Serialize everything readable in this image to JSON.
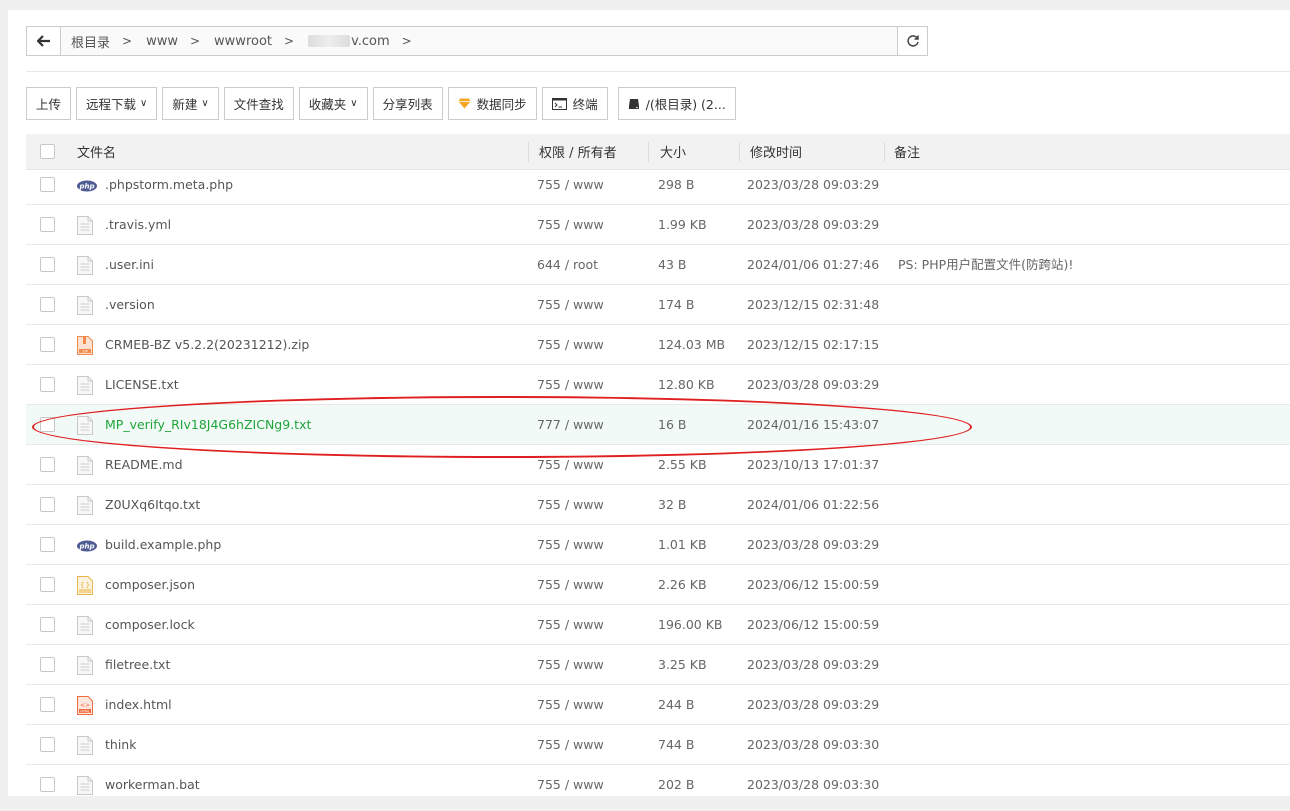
{
  "pathbar": {
    "crumbs": [
      "根目录",
      "www",
      "wwwroot"
    ],
    "domain_suffix": "v.com"
  },
  "toolbar": {
    "upload": "上传",
    "remote_download": "远程下载",
    "new": "新建",
    "file_search": "文件查找",
    "favorites": "收藏夹",
    "share_list": "分享列表",
    "sync": "数据同步",
    "terminal": "终端",
    "disk": "/(根目录) (2..."
  },
  "table": {
    "headers": {
      "name": "文件名",
      "perm": "权限 / 所有者",
      "size": "大小",
      "mtime": "修改时间",
      "note": "备注"
    },
    "rows": [
      {
        "icon": "php-icon",
        "name": ".phpstorm.meta.php",
        "perm": "755 / www",
        "size": "298 B",
        "mtime": "2023/03/28 09:03:29",
        "note": ""
      },
      {
        "icon": "file-icon",
        "name": ".travis.yml",
        "perm": "755 / www",
        "size": "1.99 KB",
        "mtime": "2023/03/28 09:03:29",
        "note": ""
      },
      {
        "icon": "file-icon",
        "name": ".user.ini",
        "perm": "644 / root",
        "size": "43 B",
        "mtime": "2024/01/06 01:27:46",
        "note": "PS: PHP用户配置文件(防跨站)!"
      },
      {
        "icon": "file-icon",
        "name": ".version",
        "perm": "755 / www",
        "size": "174 B",
        "mtime": "2023/12/15 02:31:48",
        "note": ""
      },
      {
        "icon": "zip-icon",
        "name": "CRMEB-BZ v5.2.2(20231212).zip",
        "perm": "755 / www",
        "size": "124.03 MB",
        "mtime": "2023/12/15 02:17:15",
        "note": ""
      },
      {
        "icon": "file-icon",
        "name": "LICENSE.txt",
        "perm": "755 / www",
        "size": "12.80 KB",
        "mtime": "2023/03/28 09:03:29",
        "note": ""
      },
      {
        "icon": "file-icon",
        "name": "MP_verify_RIv18J4G6hZICNg9.txt",
        "perm": "777 / www",
        "size": "16 B",
        "mtime": "2024/01/16 15:43:07",
        "note": "",
        "highlight": true
      },
      {
        "icon": "file-icon",
        "name": "README.md",
        "perm": "755 / www",
        "size": "2.55 KB",
        "mtime": "2023/10/13 17:01:37",
        "note": ""
      },
      {
        "icon": "file-icon",
        "name": "Z0UXq6Itqo.txt",
        "perm": "755 / www",
        "size": "32 B",
        "mtime": "2024/01/06 01:22:56",
        "note": ""
      },
      {
        "icon": "php-icon",
        "name": "build.example.php",
        "perm": "755 / www",
        "size": "1.01 KB",
        "mtime": "2023/03/28 09:03:29",
        "note": ""
      },
      {
        "icon": "json-icon",
        "name": "composer.json",
        "perm": "755 / www",
        "size": "2.26 KB",
        "mtime": "2023/06/12 15:00:59",
        "note": ""
      },
      {
        "icon": "file-icon",
        "name": "composer.lock",
        "perm": "755 / www",
        "size": "196.00 KB",
        "mtime": "2023/06/12 15:00:59",
        "note": ""
      },
      {
        "icon": "file-icon",
        "name": "filetree.txt",
        "perm": "755 / www",
        "size": "3.25 KB",
        "mtime": "2023/03/28 09:03:29",
        "note": ""
      },
      {
        "icon": "html-icon",
        "name": "index.html",
        "perm": "755 / www",
        "size": "244 B",
        "mtime": "2023/03/28 09:03:29",
        "note": ""
      },
      {
        "icon": "file-icon",
        "name": "think",
        "perm": "755 / www",
        "size": "744 B",
        "mtime": "2023/03/28 09:03:30",
        "note": ""
      },
      {
        "icon": "file-icon",
        "name": "workerman.bat",
        "perm": "755 / www",
        "size": "202 B",
        "mtime": "2023/03/28 09:03:30",
        "note": ""
      }
    ]
  },
  "colors": {
    "accent_green": "#20a53a",
    "annotation_red": "#e02020"
  }
}
